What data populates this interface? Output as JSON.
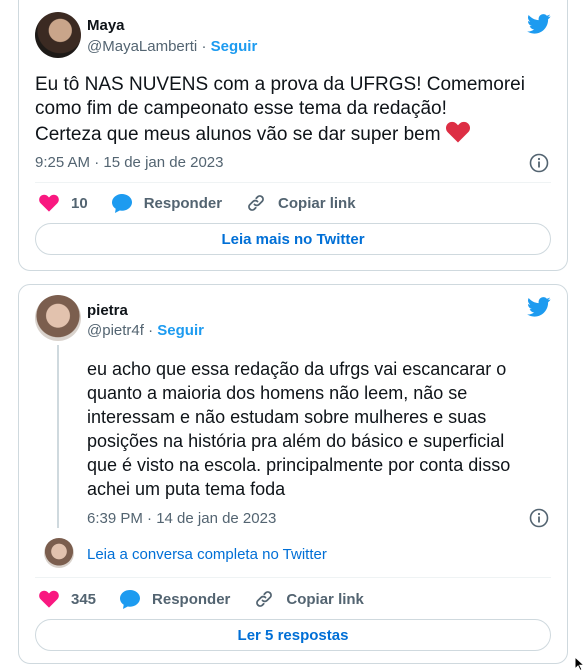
{
  "tweets": [
    {
      "name": "Maya",
      "handle": "@MayaLamberti",
      "separator": "·",
      "follow_label": "Seguir",
      "text": "Eu tô NAS NUVENS com a prova da UFRGS! Comemorei\ncomo fim de campeonato esse tema da redação!\nCerteza que meus alunos vão se dar super bem",
      "emoji": "❤️",
      "timestamp": "9:25 AM · 15 de jan de 2023",
      "like_count": "10",
      "reply_label": "Responder",
      "copy_label": "Copiar link",
      "footer_button": "Leia mais no Twitter"
    },
    {
      "name": "pietra",
      "handle": "@pietr4f",
      "separator": "·",
      "follow_label": "Seguir",
      "text": "eu acho que essa redação da ufrgs vai escancarar o\nquanto a maioria dos homens não leem, não se\ninteressam e não estudam sobre mulheres e suas\nposições na história pra além do básico e superficial\nque é visto na escola. principalmente por conta disso\nachei um puta tema foda",
      "timestamp": "6:39 PM · 14 de jan de 2023",
      "conversation_link": "Leia a conversa completa no Twitter",
      "like_count": "345",
      "reply_label": "Responder",
      "copy_label": "Copiar link",
      "footer_button": "Ler 5 respostas"
    }
  ],
  "colors": {
    "brand": "#1d9bf0",
    "like": "#f91880",
    "link": "#006fd6"
  },
  "icons": [
    "twitter-bird-icon",
    "info-icon",
    "heart-icon",
    "reply-bubble-icon",
    "link-icon",
    "mouse-cursor-icon"
  ]
}
